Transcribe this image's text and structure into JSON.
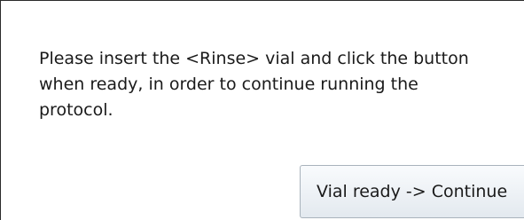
{
  "dialog": {
    "message": "Please insert the <Rinse> vial and click the button\nwhen ready, in order to continue running the\nprotocol.",
    "continue_button_label": "Vial ready -> Continue"
  }
}
